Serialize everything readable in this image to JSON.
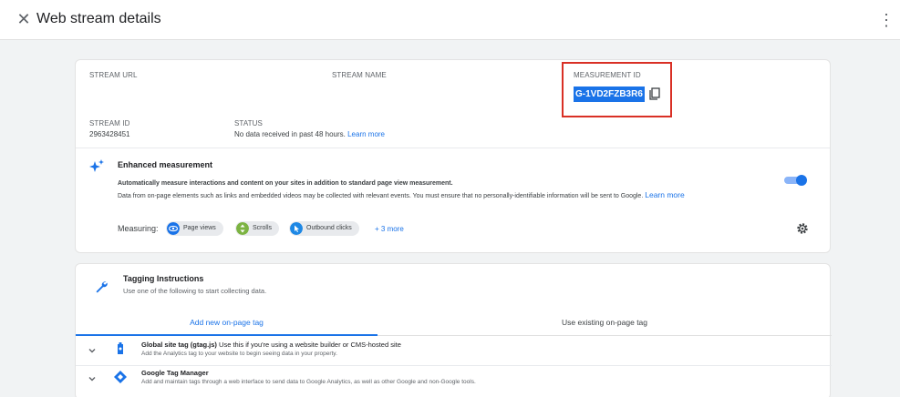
{
  "header": {
    "title": "Web stream details",
    "close_icon": "close-icon",
    "menu_icon": "more-vert-icon"
  },
  "stream": {
    "url_label": "STREAM URL",
    "url_value": "",
    "name_label": "STREAM NAME",
    "name_value": "",
    "measurement_id_label": "MEASUREMENT ID",
    "measurement_id": "G-1VD2FZB3R6",
    "id_label": "STREAM ID",
    "id_value": "2963428451",
    "status_label": "STATUS",
    "status_text": "No data received in past 48 hours.",
    "status_link": "Learn more"
  },
  "enhanced": {
    "title": "Enhanced measurement",
    "desc1": "Automatically measure interactions and content on your sites in addition to standard page view measurement.",
    "desc2": "Data from on-page elements such as links and embedded videos may be collected with relevant events. You must ensure that no personally-identifiable information will be sent to Google.",
    "desc2_link": "Learn more",
    "enabled": true,
    "measuring_label": "Measuring:",
    "chips": [
      {
        "label": "Page views",
        "icon": "eye-icon",
        "color": "#1a73e8"
      },
      {
        "label": "Scrolls",
        "icon": "scroll-icon",
        "color": "#7cb342"
      },
      {
        "label": "Outbound clicks",
        "icon": "pointer-icon",
        "color": "#1e88e5"
      }
    ],
    "more_link": "+ 3 more"
  },
  "tagging": {
    "title": "Tagging Instructions",
    "subtitle": "Use one of the following to start collecting data.",
    "tabs": [
      {
        "label": "Add new on-page tag",
        "active": true
      },
      {
        "label": "Use existing on-page tag",
        "active": false
      }
    ],
    "options": [
      {
        "title_bold": "Global site tag (gtag.js)",
        "title_rest": " Use this if you're using a website builder or CMS-hosted site",
        "desc": "Add the Analytics tag to your website to begin seeing data in your property."
      },
      {
        "title_bold": "Google Tag Manager",
        "title_rest": "",
        "desc": "Add and maintain tags through a web interface to send data to Google Analytics, as well as other Google and non-Google tools."
      }
    ]
  },
  "colors": {
    "accent": "#1a73e8",
    "highlight_border": "#d93025"
  }
}
